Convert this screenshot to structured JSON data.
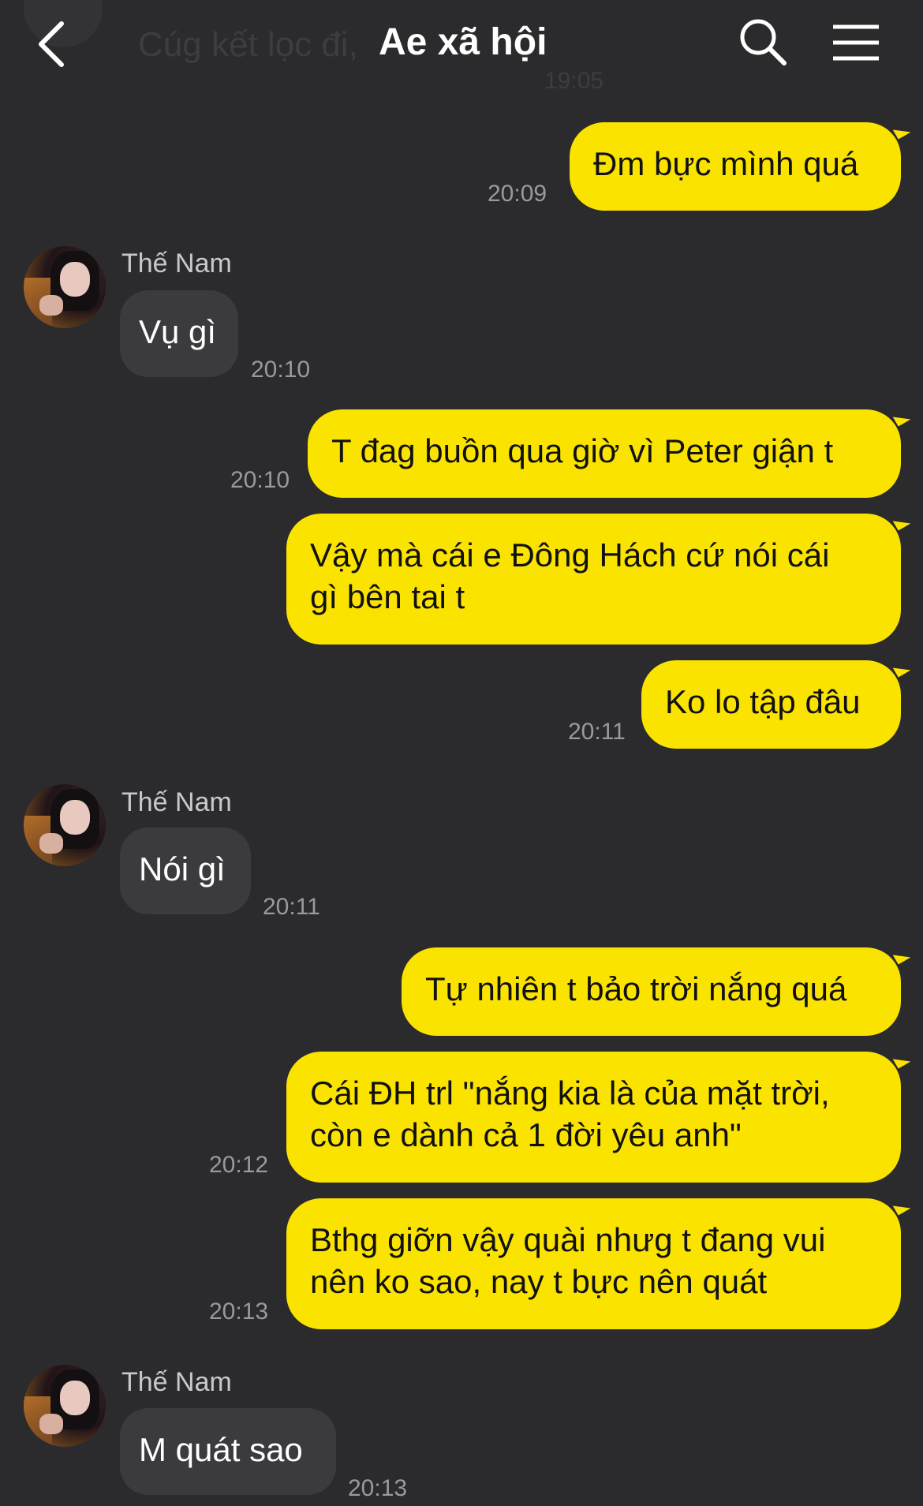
{
  "header": {
    "title": "Ae xã hội",
    "ghost_message": "Cúg kết lọc đi,",
    "ghost_time": "19:05",
    "back_icon": "chevron-left-icon",
    "search_icon": "search-icon",
    "menu_icon": "hamburger-menu-icon"
  },
  "colors": {
    "background": "#2b2b2d",
    "outgoing_bubble": "#fbe300",
    "incoming_bubble": "#3b3b3e",
    "timestamp": "#9a9a9d"
  },
  "messages": [
    {
      "direction": "out",
      "text": "Đm bực mình quá",
      "time": "20:09"
    },
    {
      "direction": "in",
      "sender": "Thế Nam",
      "text": "Vụ gì",
      "time": "20:10"
    },
    {
      "direction": "out",
      "text": "T đag buồn qua giờ vì Peter giận t",
      "time": "20:10"
    },
    {
      "direction": "out",
      "lines": [
        "Vậy mà cái e Đông Hách cứ nói cái",
        "gì bên tai t"
      ],
      "time": ""
    },
    {
      "direction": "out",
      "text": "Ko lo tập đâu",
      "time": "20:11"
    },
    {
      "direction": "in",
      "sender": "Thế Nam",
      "text": "Nói gì",
      "time": "20:11"
    },
    {
      "direction": "out",
      "text": "Tự nhiên t bảo trời nắng quá",
      "time": ""
    },
    {
      "direction": "out",
      "lines": [
        "Cái ĐH trl \"nắng kia là của mặt trời,",
        "còn e dành cả 1 đời yêu anh\""
      ],
      "time": "20:12"
    },
    {
      "direction": "out",
      "lines": [
        "Bthg giỡn vậy quài nhưg t đang vui",
        "nên ko sao, nay t bực nên quát"
      ],
      "time": "20:13"
    },
    {
      "direction": "in",
      "sender": "Thế Nam",
      "text": "M quát sao",
      "time": "20:13"
    }
  ]
}
